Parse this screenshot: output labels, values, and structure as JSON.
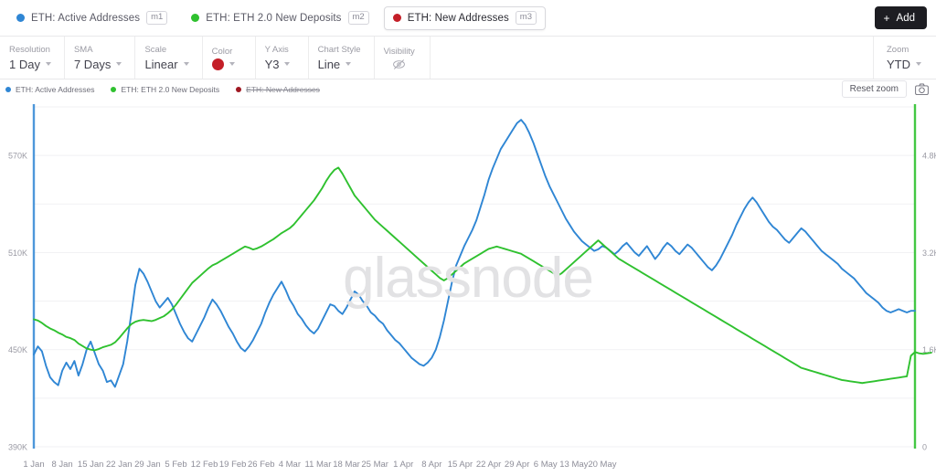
{
  "metric_tabs": [
    {
      "label": "ETH: Active Addresses",
      "chip": "m1",
      "color": "#2f86d4",
      "selected": false
    },
    {
      "label": "ETH: ETH 2.0 New Deposits",
      "chip": "m2",
      "color": "#2fc12f",
      "selected": false
    },
    {
      "label": "ETH: New Addresses",
      "chip": "m3",
      "color": "#c41f28",
      "selected": true
    }
  ],
  "add_button": {
    "plus": "+",
    "label": "Add"
  },
  "controls": [
    {
      "label": "Resolution",
      "value": "1 Day",
      "type": "select"
    },
    {
      "label": "SMA",
      "value": "7 Days",
      "type": "select"
    },
    {
      "label": "Scale",
      "value": "Linear",
      "type": "select"
    },
    {
      "label": "Color",
      "value": "",
      "type": "color",
      "color": "#c41f28"
    },
    {
      "label": "Y Axis",
      "value": "Y3",
      "type": "select"
    },
    {
      "label": "Chart Style",
      "value": "Line",
      "type": "select"
    },
    {
      "label": "Visibility",
      "value": "",
      "type": "icon",
      "icon": "eye-slash-icon"
    }
  ],
  "zoom_control": {
    "label": "Zoom",
    "value": "YTD"
  },
  "chart_legend": [
    {
      "label": "ETH: Active Addresses",
      "color": "#2f86d4",
      "hidden": false
    },
    {
      "label": "ETH: ETH 2.0 New Deposits",
      "color": "#2fc12f",
      "hidden": false
    },
    {
      "label": "ETH: New Addresses",
      "color": "#a01822",
      "hidden": true
    }
  ],
  "legend_actions": {
    "reset_zoom": "Reset zoom",
    "camera_icon": "camera-icon"
  },
  "watermark": "glassnode",
  "chart_data": {
    "type": "line",
    "title": "",
    "xlabel": "",
    "grid": true,
    "legend_position": "top-left",
    "x_ticks": [
      "1 Jan",
      "8 Jan",
      "15 Jan",
      "22 Jan",
      "29 Jan",
      "5 Feb",
      "12 Feb",
      "19 Feb",
      "26 Feb",
      "4 Mar",
      "11 Mar",
      "18 Mar",
      "25 Mar",
      "1 Apr",
      "8 Apr",
      "15 Apr",
      "22 Apr",
      "29 Apr",
      "6 May",
      "13 May",
      "20 May"
    ],
    "x_range": [
      "1 Jan",
      "24 May"
    ],
    "axes": [
      {
        "id": "y1",
        "side": "left",
        "color": "#2f86d4",
        "ylabel": "",
        "ylim": [
          390000,
          600000
        ],
        "tick_labels": [
          "570K",
          "510K",
          "450K",
          "390K"
        ],
        "tick_values": [
          570000,
          510000,
          450000,
          390000
        ]
      },
      {
        "id": "y2",
        "side": "right",
        "color": "#2fc12f",
        "ylabel": "",
        "ylim": [
          0,
          5600
        ],
        "tick_labels": [
          "4.8K",
          "3.2K",
          "1.6K",
          "0"
        ],
        "tick_values": [
          4800,
          3200,
          1600,
          0
        ]
      }
    ],
    "series": [
      {
        "name": "ETH: Active Addresses",
        "axis": "y1",
        "color": "#2f86d4",
        "values": [
          447000,
          452000,
          449000,
          440000,
          433000,
          430000,
          428000,
          437000,
          442000,
          438000,
          443000,
          434000,
          441000,
          450000,
          455000,
          448000,
          441000,
          437000,
          430000,
          431000,
          427000,
          434000,
          441000,
          455000,
          472000,
          490000,
          500000,
          497000,
          492000,
          486000,
          480000,
          476000,
          479000,
          482000,
          478000,
          472000,
          466000,
          461000,
          457000,
          455000,
          460000,
          465000,
          470000,
          476000,
          481000,
          478000,
          474000,
          469000,
          464000,
          460000,
          455000,
          451000,
          449000,
          452000,
          456000,
          461000,
          466000,
          473000,
          479000,
          484000,
          488000,
          492000,
          487000,
          481000,
          477000,
          472000,
          469000,
          465000,
          462000,
          460000,
          463000,
          468000,
          473000,
          478000,
          477000,
          474000,
          472000,
          476000,
          481000,
          486000,
          484000,
          480000,
          477000,
          473000,
          471000,
          468000,
          466000,
          462000,
          459000,
          456000,
          454000,
          451000,
          448000,
          445000,
          443000,
          441000,
          440000,
          442000,
          445000,
          450000,
          458000,
          468000,
          480000,
          492000,
          502000,
          508000,
          514000,
          519000,
          524000,
          530000,
          538000,
          546000,
          555000,
          562000,
          568000,
          574000,
          578000,
          582000,
          586000,
          590000,
          592000,
          589000,
          584000,
          578000,
          571000,
          564000,
          557000,
          551000,
          546000,
          541000,
          536000,
          531000,
          527000,
          523000,
          520000,
          517000,
          515000,
          513000,
          511000,
          512000,
          514000,
          513000,
          511000,
          509000,
          511000,
          514000,
          516000,
          513000,
          510000,
          508000,
          511000,
          514000,
          510000,
          506000,
          509000,
          513000,
          516000,
          514000,
          511000,
          509000,
          512000,
          515000,
          513000,
          510000,
          507000,
          504000,
          501000,
          499000,
          502000,
          506000,
          511000,
          516000,
          521000,
          527000,
          532000,
          537000,
          541000,
          544000,
          541000,
          537000,
          533000,
          529000,
          526000,
          524000,
          521000,
          518000,
          516000,
          519000,
          522000,
          525000,
          523000,
          520000,
          517000,
          514000,
          511000,
          509000,
          507000,
          505000,
          503000,
          500000,
          498000,
          496000,
          494000,
          491000,
          488000,
          485000,
          483000,
          481000,
          479000,
          476000,
          474000,
          473000,
          474000,
          475000,
          474000,
          473000,
          474000,
          474000
        ]
      },
      {
        "name": "ETH: ETH 2.0 New Deposits",
        "axis": "y2",
        "color": "#2fc12f",
        "values": [
          2100,
          2080,
          2040,
          1990,
          1950,
          1920,
          1880,
          1850,
          1810,
          1790,
          1760,
          1700,
          1660,
          1620,
          1600,
          1590,
          1610,
          1640,
          1660,
          1680,
          1720,
          1790,
          1870,
          1950,
          2020,
          2060,
          2080,
          2090,
          2080,
          2070,
          2090,
          2120,
          2150,
          2200,
          2260,
          2340,
          2430,
          2520,
          2610,
          2700,
          2760,
          2820,
          2880,
          2940,
          2990,
          3020,
          3060,
          3100,
          3140,
          3180,
          3220,
          3260,
          3300,
          3280,
          3250,
          3270,
          3300,
          3340,
          3380,
          3420,
          3470,
          3520,
          3560,
          3600,
          3660,
          3740,
          3820,
          3900,
          3980,
          4060,
          4160,
          4260,
          4380,
          4480,
          4560,
          4600,
          4500,
          4380,
          4260,
          4140,
          4060,
          3980,
          3900,
          3820,
          3740,
          3680,
          3620,
          3560,
          3500,
          3440,
          3380,
          3320,
          3260,
          3200,
          3140,
          3080,
          3020,
          2960,
          2900,
          2840,
          2780,
          2740,
          2780,
          2840,
          2900,
          2960,
          3020,
          3060,
          3100,
          3140,
          3180,
          3220,
          3260,
          3280,
          3300,
          3280,
          3260,
          3240,
          3220,
          3200,
          3180,
          3140,
          3100,
          3060,
          3020,
          2980,
          2940,
          2900,
          2860,
          2820,
          2860,
          2920,
          2980,
          3040,
          3100,
          3160,
          3220,
          3280,
          3340,
          3400,
          3340,
          3280,
          3220,
          3160,
          3100,
          3060,
          3020,
          2980,
          2940,
          2900,
          2860,
          2820,
          2780,
          2740,
          2700,
          2660,
          2620,
          2580,
          2540,
          2500,
          2460,
          2420,
          2380,
          2340,
          2300,
          2260,
          2220,
          2180,
          2140,
          2100,
          2060,
          2020,
          1980,
          1940,
          1900,
          1860,
          1820,
          1780,
          1740,
          1700,
          1660,
          1620,
          1580,
          1540,
          1500,
          1460,
          1420,
          1380,
          1340,
          1300,
          1280,
          1260,
          1240,
          1220,
          1200,
          1180,
          1160,
          1140,
          1120,
          1100,
          1090,
          1080,
          1070,
          1060,
          1050,
          1060,
          1070,
          1080,
          1090,
          1100,
          1110,
          1120,
          1130,
          1140,
          1150,
          1160,
          1500,
          1560,
          1540,
          1530,
          1540,
          1550
        ]
      },
      {
        "name": "ETH: New Addresses",
        "axis": "y3",
        "color": "#a01822",
        "hidden": true,
        "values": []
      }
    ]
  }
}
